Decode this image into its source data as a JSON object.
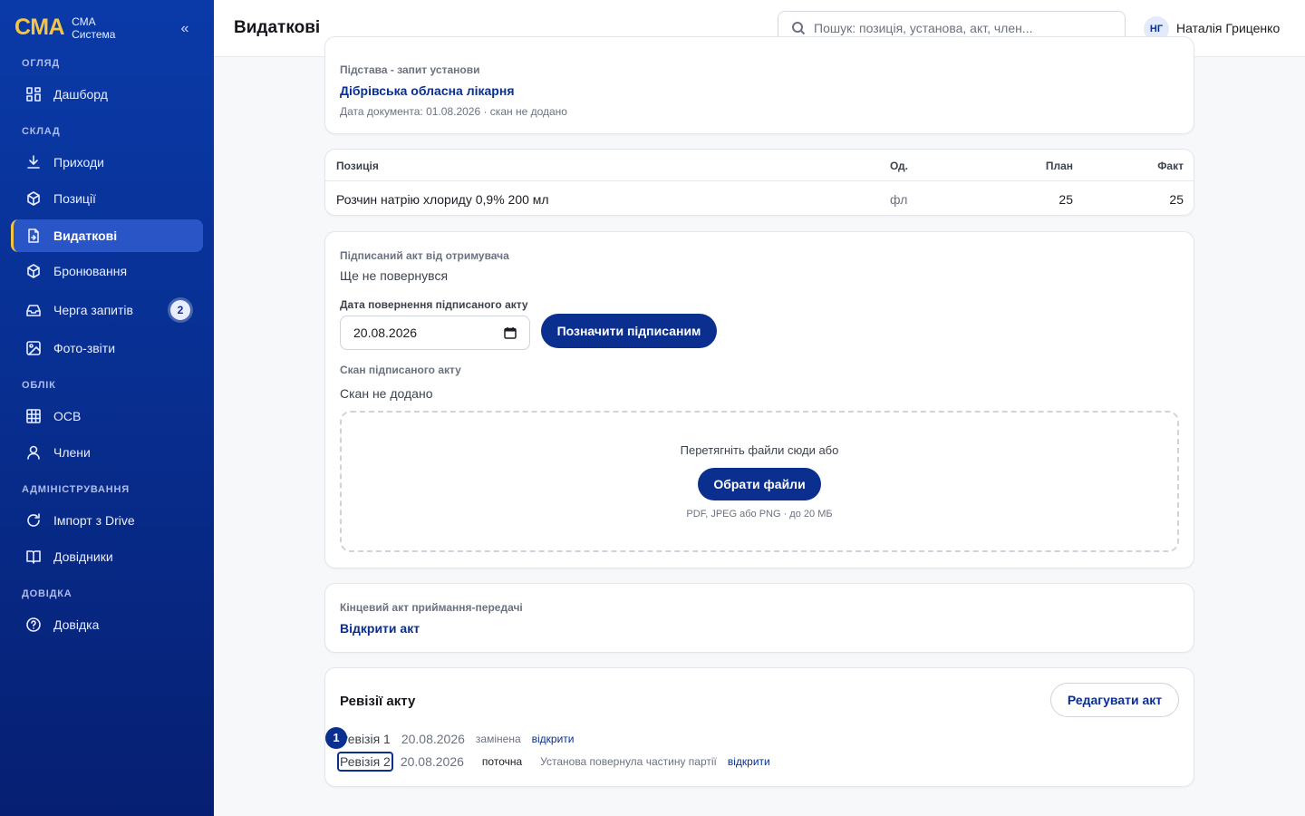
{
  "brand": {
    "logo": "СМА",
    "line1": "СМА",
    "line2": "Система",
    "collapse": "«"
  },
  "nav": {
    "sections": [
      {
        "title": "ОГЛЯД"
      },
      {
        "title": "СКЛАД"
      },
      {
        "title": "ОБЛІК"
      },
      {
        "title": "АДМІНІСТРУВАННЯ"
      },
      {
        "title": "ДОВІДКА"
      }
    ],
    "items": [
      {
        "label": "Дашборд",
        "icon": "grid-icon"
      },
      {
        "label": "Приходи",
        "icon": "download-icon"
      },
      {
        "label": "Позиції",
        "icon": "box-icon"
      },
      {
        "label": "Видаткові",
        "icon": "file-out-icon",
        "active": true
      },
      {
        "label": "Бронювання",
        "icon": "box-icon"
      },
      {
        "label": "Черга запитів",
        "icon": "inbox-icon",
        "badge": "2"
      },
      {
        "label": "Фото-звіти",
        "icon": "image-icon"
      },
      {
        "label": "ОСВ",
        "icon": "table-icon"
      },
      {
        "label": "Члени",
        "icon": "user-icon"
      },
      {
        "label": "Імпорт з Drive",
        "icon": "refresh-icon"
      },
      {
        "label": "Довідники",
        "icon": "book-icon"
      },
      {
        "label": "Довідка",
        "icon": "help-circle-icon"
      }
    ]
  },
  "header": {
    "title": "Видаткові",
    "search_placeholder": "Пошук: позиція, установа, акт, член...",
    "user_initials": "НГ",
    "user_name": "Наталія Гриценко"
  },
  "basis": {
    "label": "Підстава - запит установи",
    "institution": "Дібрівська обласна лікарня",
    "meta": "Дата документа: 01.08.2026 · скан не додано"
  },
  "table": {
    "columns": [
      "Позиція",
      "Од.",
      "План",
      "Факт"
    ],
    "rows": [
      {
        "name": "Розчин натрію хлориду 0,9% 200 мл",
        "unit": "фл",
        "plan": "25",
        "fact": "25"
      }
    ]
  },
  "signed": {
    "label": "Підписаний акт від отримувача",
    "status": "Ще не повернувся",
    "date_label": "Дата повернення підписаного акту",
    "date_value": "20.08.2026",
    "mark_button": "Позначити підписаним",
    "scan_label": "Скан підписаного акту",
    "scan_status": "Скан не додано",
    "drop_text": "Перетягніть файли сюди або",
    "choose_button": "Обрати файли",
    "drop_hint": "PDF, JPEG або PNG · до 20 МБ"
  },
  "final_act": {
    "label": "Кінцевий акт приймання-передачі",
    "open_link": "Відкрити акт"
  },
  "revisions": {
    "title": "Ревізії акту",
    "edit_button": "Редагувати акт",
    "marker": "1",
    "items": [
      {
        "name": "Ревізія 1",
        "date": "20.08.2026",
        "status": "замінена",
        "note": "",
        "link": "відкрити"
      },
      {
        "name": "Ревізія 2",
        "date": "20.08.2026",
        "status": "поточна",
        "note": "Установа повернула частину партії",
        "link": "відкрити"
      }
    ]
  }
}
